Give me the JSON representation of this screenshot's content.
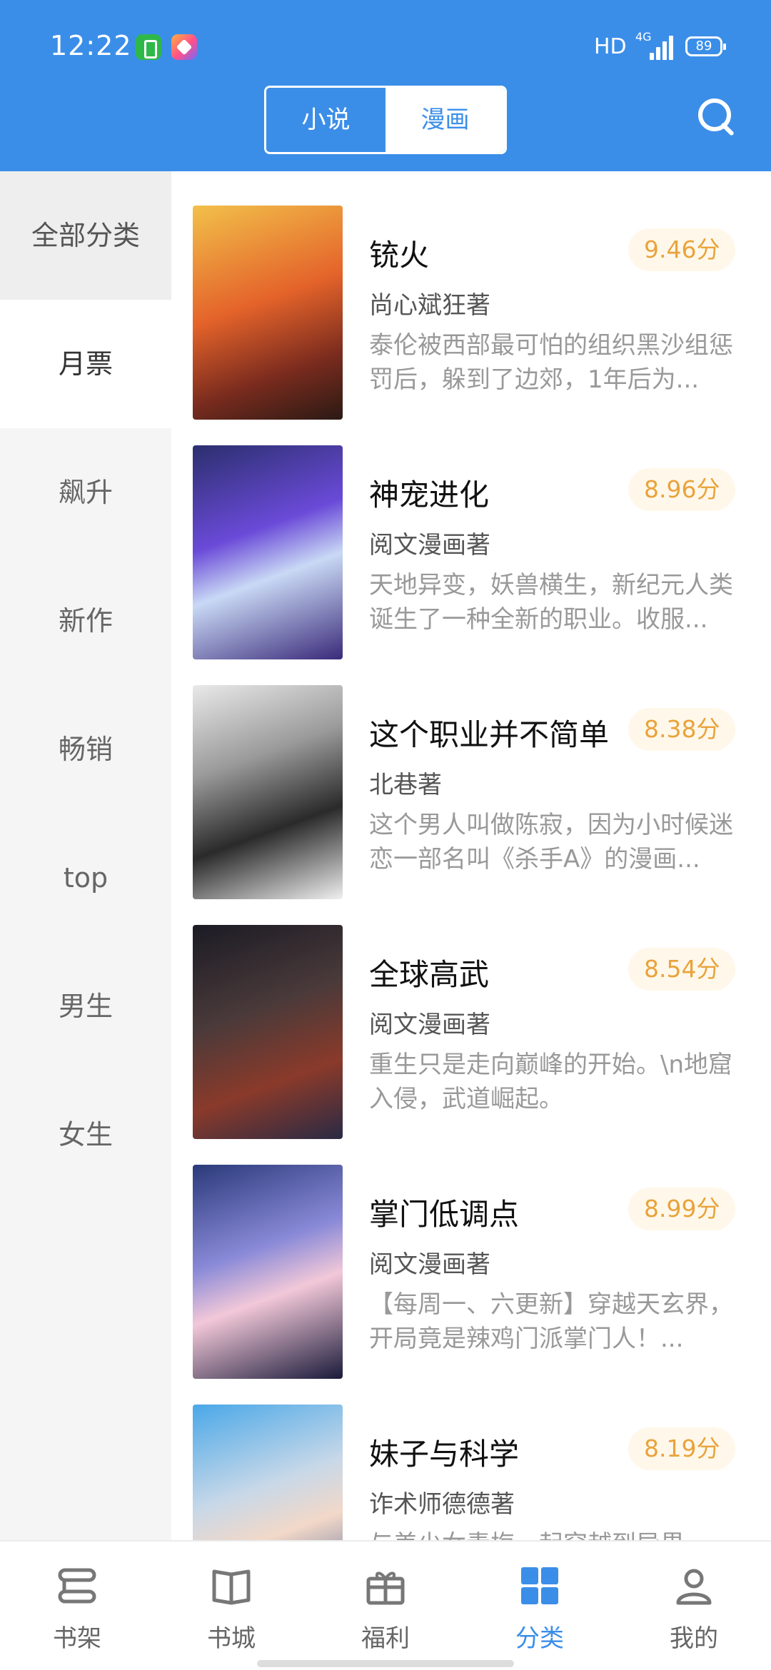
{
  "status_bar": {
    "time": "12:22",
    "hd": "HD",
    "network": "4G",
    "battery": "89"
  },
  "header": {
    "tabs": [
      "小说",
      "漫画"
    ],
    "active_tab": 1
  },
  "sidebar": {
    "items": [
      "全部分类",
      "月票",
      "飙升",
      "新作",
      "畅销",
      "top",
      "男生",
      "女生"
    ]
  },
  "books": [
    {
      "title": "铳火",
      "score": "9.46分",
      "author": "尚心斌狂著",
      "desc": "泰伦被西部最可怕的组织黑沙组惩罚后，躲到了边郊，1年后为..."
    },
    {
      "title": "神宠进化",
      "score": "8.96分",
      "author": "阅文漫画著",
      "desc": "天地异变，妖兽横生，新纪元人类诞生了一种全新的职业。收服..."
    },
    {
      "title": "这个职业并不简单",
      "score": "8.38分",
      "author": "北巷著",
      "desc": "这个男人叫做陈寂，因为小时候迷恋一部名叫《杀手A》的漫画..."
    },
    {
      "title": "全球高武",
      "score": "8.54分",
      "author": "阅文漫画著",
      "desc": "重生只是走向巅峰的开始。\\n地窟入侵，武道崛起。"
    },
    {
      "title": "掌门低调点",
      "score": "8.99分",
      "author": "阅文漫画著",
      "desc": "【每周一、六更新】穿越天玄界，开局竟是辣鸡门派掌门人！..."
    },
    {
      "title": "妹子与科学",
      "score": "8.19分",
      "author": "诈术师德德著",
      "desc": "与美少女青梅一起穿越到异界..."
    }
  ],
  "bottom_nav": {
    "items": [
      "书架",
      "书城",
      "福利",
      "分类",
      "我的"
    ],
    "active": 3
  },
  "colors": {
    "brand": "#3b8ee8",
    "score": "#e9a33c",
    "score_bg": "#fff8ea"
  }
}
